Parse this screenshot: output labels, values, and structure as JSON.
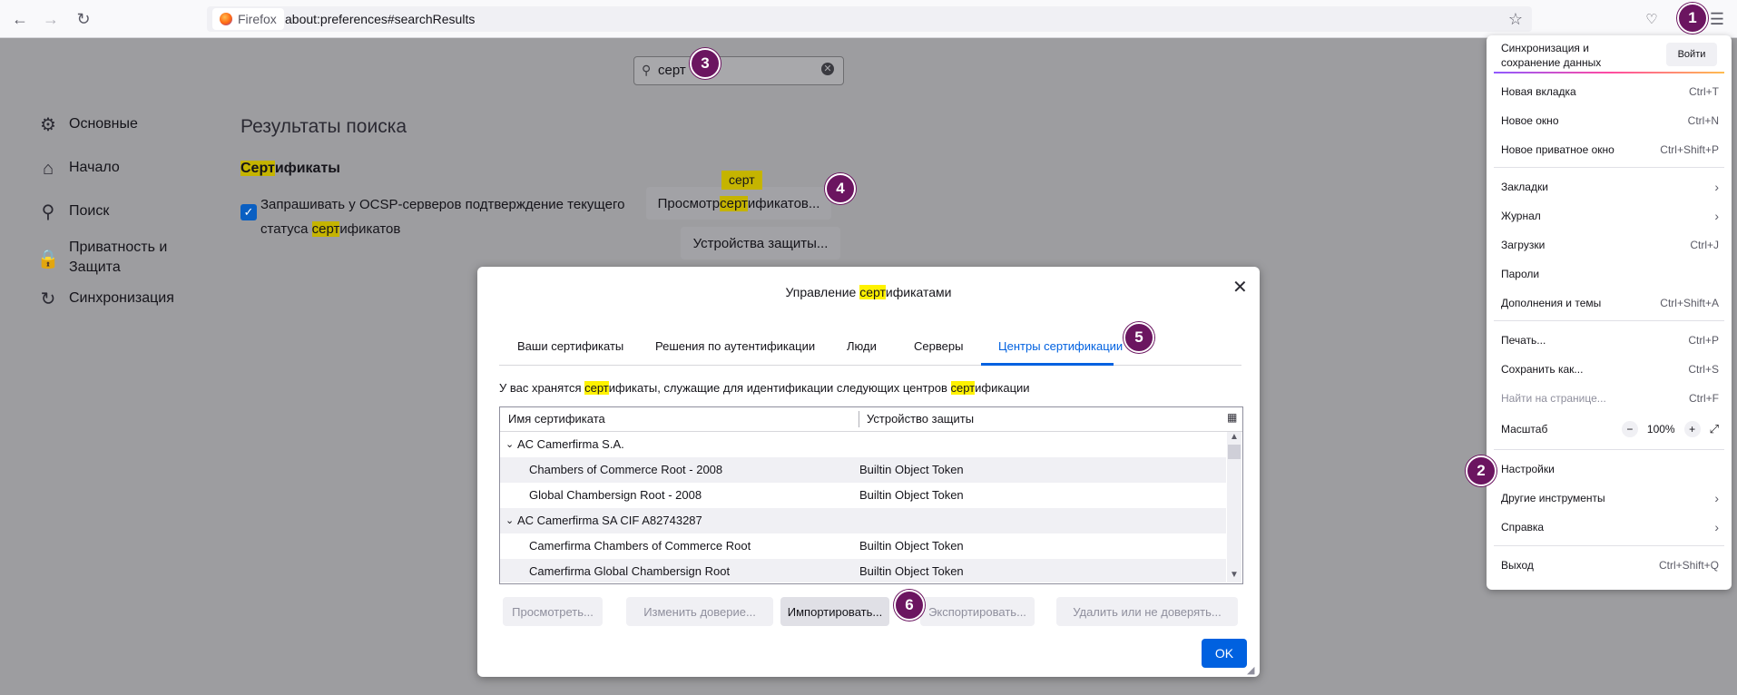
{
  "browser": {
    "identity_label": "Firefox",
    "url": "about:preferences#searchResults"
  },
  "prefs": {
    "search_value": "серт",
    "nav": [
      {
        "label": "Основные",
        "icon": "gear-icon"
      },
      {
        "label": "Начало",
        "icon": "home-icon"
      },
      {
        "label": "Поиск",
        "icon": "search-icon"
      },
      {
        "label": "Приватность и Защита",
        "icon": "lock-icon"
      },
      {
        "label": "Синхронизация",
        "icon": "sync-icon"
      }
    ],
    "results_title": "Результаты поиска",
    "section": {
      "hl": "Серт",
      "rest": "ификаты"
    },
    "ocsp": {
      "p1": "Запрашивать у OCSP-серверов подтверждение текущего",
      "p2": "статуса ",
      "hl": "серт",
      "p3": "ификатов"
    },
    "view_btn": {
      "p1": "Просмотр ",
      "hl": "серт",
      "p2": "ификатов..."
    },
    "devices_btn": "Устройства защиты...",
    "tooltip": "серт"
  },
  "dialog": {
    "title": {
      "p1": "Управление ",
      "hl": "серт",
      "p2": "ификатами"
    },
    "tabs": [
      "Ваши сертификаты",
      "Решения по аутентификации",
      "Люди",
      "Серверы",
      "Центры сертификации"
    ],
    "description": {
      "p1": "У вас хранятся ",
      "hl1": "серт",
      "p2": "ификаты, служащие для идентификации следующих центров ",
      "hl2": "серт",
      "p3": "ификации"
    },
    "columns": [
      "Имя сертификата",
      "Устройство защиты"
    ],
    "rows": [
      {
        "name": "AC Camerfirma S.A.",
        "device": ""
      },
      {
        "name": "Chambers of Commerce Root - 2008",
        "device": "Builtin Object Token"
      },
      {
        "name": "Global Chambersign Root - 2008",
        "device": "Builtin Object Token"
      },
      {
        "name": "AC Camerfirma SA CIF A82743287",
        "device": ""
      },
      {
        "name": "Camerfirma Chambers of Commerce Root",
        "device": "Builtin Object Token"
      },
      {
        "name": "Camerfirma Global Chambersign Root",
        "device": "Builtin Object Token"
      }
    ],
    "buttons": [
      "Просмотреть...",
      "Изменить доверие...",
      "Импортировать...",
      "Экспортировать...",
      "Удалить или не доверять..."
    ],
    "ok": "OK"
  },
  "menu": {
    "sync_label": "Синхронизация и сохранение данных",
    "signin": "Войти",
    "items": [
      {
        "label": "Новая вкладка",
        "shortcut": "Ctrl+T"
      },
      {
        "label": "Новое окно",
        "shortcut": "Ctrl+N"
      },
      {
        "label": "Новое приватное окно",
        "shortcut": "Ctrl+Shift+P"
      },
      {
        "label": "Закладки",
        "shortcut": ""
      },
      {
        "label": "Журнал",
        "shortcut": ""
      },
      {
        "label": "Загрузки",
        "shortcut": "Ctrl+J"
      },
      {
        "label": "Пароли",
        "shortcut": ""
      },
      {
        "label": "Дополнения и темы",
        "shortcut": "Ctrl+Shift+A"
      },
      {
        "label": "Печать...",
        "shortcut": "Ctrl+P"
      },
      {
        "label": "Сохранить как...",
        "shortcut": "Ctrl+S"
      },
      {
        "label": "Найти на странице...",
        "shortcut": "Ctrl+F"
      },
      {
        "label": "Масштаб",
        "shortcut": ""
      },
      {
        "label": "Настройки",
        "shortcut": ""
      },
      {
        "label": "Другие инструменты",
        "shortcut": ""
      },
      {
        "label": "Справка",
        "shortcut": ""
      },
      {
        "label": "Выход",
        "shortcut": "Ctrl+Shift+Q"
      }
    ],
    "zoom": {
      "minus": "−",
      "value": "100%",
      "plus": "+"
    }
  },
  "badges": [
    "1",
    "2",
    "3",
    "4",
    "5",
    "6"
  ]
}
